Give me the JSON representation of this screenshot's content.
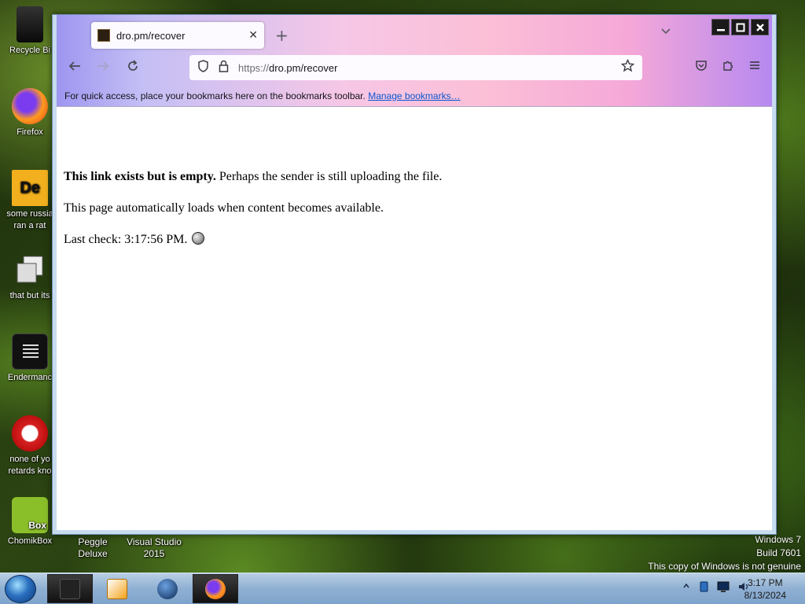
{
  "desktop": {
    "icons": [
      {
        "label": "Recycle Bi",
        "icon": "recycle-bin-icon"
      },
      {
        "label": "Firefox",
        "icon": "firefox-icon"
      },
      {
        "label": "some russia ran a rat",
        "icon": "de-app-icon"
      },
      {
        "label": "that but its",
        "icon": "stacked-windows-icon"
      },
      {
        "label": "Endermanc",
        "icon": "terminal-icon"
      },
      {
        "label": "none of yo retards kno",
        "icon": "red-dragon-icon"
      },
      {
        "label": "ChomikBox",
        "icon": "chomikbox-icon"
      }
    ],
    "chomik_badge": "Box",
    "bottom_labels": [
      "Peggle Deluxe",
      "Visual Studio 2015"
    ]
  },
  "watermark": {
    "line1": "Windows 7",
    "line2": "Build 7601",
    "line3": "This copy of Windows is not genuine"
  },
  "browser": {
    "tab_title": "dro.pm/recover",
    "tab_close": "✕",
    "new_tab": "+",
    "url_scheme": "https://",
    "url_rest": "dro.pm/recover",
    "bookmarks_text": "For quick access, place your bookmarks here on the bookmarks toolbar.",
    "bookmarks_link": "Manage bookmarks…"
  },
  "page": {
    "line1_bold": "This link exists but is empty.",
    "line1_rest": " Perhaps the sender is still uploading the file.",
    "line2": "This page automatically loads when content becomes available.",
    "line3": "Last check: 3:17:56 PM."
  },
  "taskbar": {
    "time": "3:17 PM",
    "date": "8/13/2024"
  }
}
